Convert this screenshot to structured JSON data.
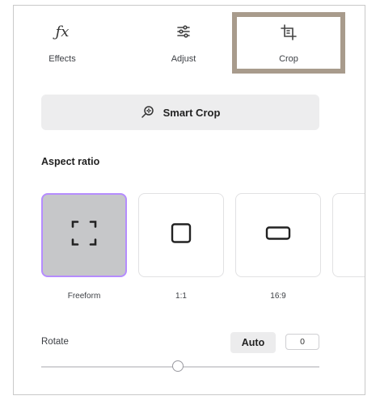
{
  "tabs": [
    {
      "label": "Effects",
      "icon": "fx-icon"
    },
    {
      "label": "Adjust",
      "icon": "sliders-icon"
    },
    {
      "label": "Crop",
      "icon": "crop-icon"
    }
  ],
  "active_tab": "Crop",
  "smart_crop": {
    "label": "Smart Crop",
    "icon": "magic-search-icon"
  },
  "aspect_ratio": {
    "title": "Aspect ratio",
    "options": [
      {
        "label": "Freeform",
        "icon": "freeform-corners-icon",
        "selected": true
      },
      {
        "label": "1:1",
        "icon": "square-icon",
        "selected": false
      },
      {
        "label": "16:9",
        "icon": "wide-rectangle-icon",
        "selected": false
      }
    ]
  },
  "rotate": {
    "label": "Rotate",
    "auto_label": "Auto",
    "value": "0"
  },
  "colors": {
    "selected_border": "#b58cff",
    "active_tab_border": "#a89b8c"
  }
}
